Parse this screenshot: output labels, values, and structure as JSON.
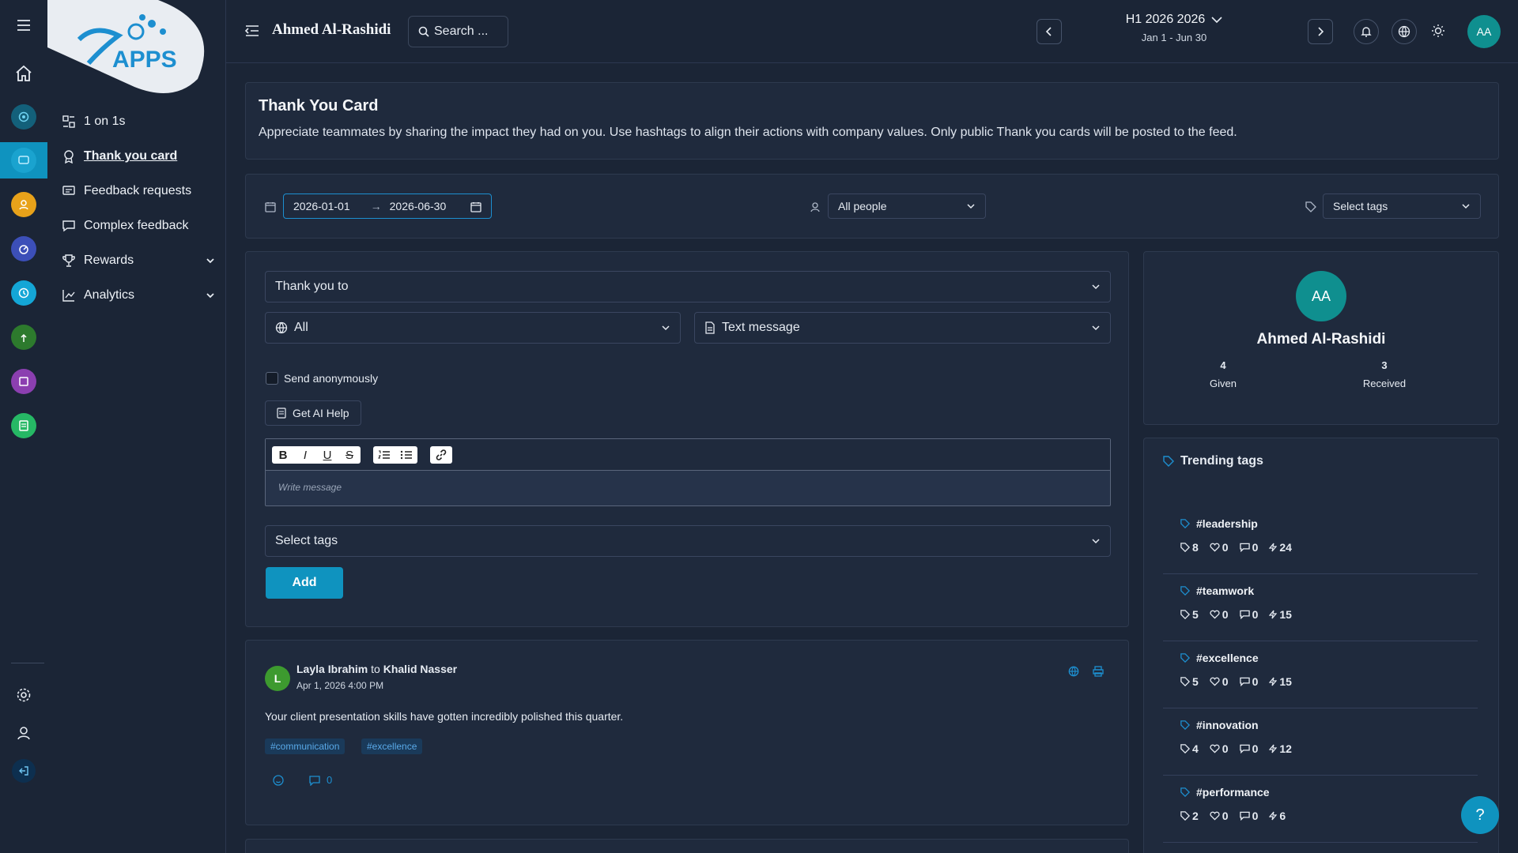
{
  "logo": {
    "text": "APPS"
  },
  "sidebar": {
    "items": [
      {
        "label": "1 on 1s"
      },
      {
        "label": "Thank you card"
      },
      {
        "label": "Feedback requests"
      },
      {
        "label": "Complex feedback"
      },
      {
        "label": "Rewards"
      },
      {
        "label": "Analytics"
      }
    ]
  },
  "topbar": {
    "user_name": "Ahmed Al-Rashidi",
    "search_label": "Search ...",
    "period_title": "H1 2026 2026",
    "period_range": "Jan 1 - Jun 30",
    "avatar": "AA"
  },
  "header": {
    "title": "Thank You Card",
    "description": "Appreciate teammates by sharing the impact they had on you. Use hashtags to align their actions with company values. Only public Thank you cards will be posted to the feed."
  },
  "filters": {
    "date_from": "2026-01-01",
    "date_arrow": "→",
    "date_to": "2026-06-30",
    "people": "All people",
    "tags": "Select tags"
  },
  "form": {
    "recipient_placeholder": "Thank you to",
    "visibility": "All",
    "message_type": "Text message",
    "anonymous_label": "Send anonymously",
    "ai_help": "Get AI Help",
    "toolbar": {
      "bold": "B",
      "italic": "I",
      "underline": "U",
      "strike": "S"
    },
    "message_placeholder": "Write message",
    "tags_placeholder": "Select tags",
    "add_label": "Add"
  },
  "feed": [
    {
      "avatar": "L",
      "from": "Layla Ibrahim",
      "connector": "to",
      "to": "Khalid Nasser",
      "time": "Apr 1, 2026 4:00 PM",
      "message": "Your client presentation skills have gotten incredibly polished this quarter.",
      "tags": [
        "#communication",
        "#excellence"
      ],
      "comments": "0"
    }
  ],
  "profile": {
    "avatar": "AA",
    "name": "Ahmed Al-Rashidi",
    "given_count": "4",
    "given_label": "Given",
    "received_count": "3",
    "received_label": "Received"
  },
  "trending": {
    "title": "Trending tags",
    "tags": [
      {
        "name": "#leadership",
        "uses": "8",
        "likes": "0",
        "comments": "0",
        "score": "24"
      },
      {
        "name": "#teamwork",
        "uses": "5",
        "likes": "0",
        "comments": "0",
        "score": "15"
      },
      {
        "name": "#excellence",
        "uses": "5",
        "likes": "0",
        "comments": "0",
        "score": "15"
      },
      {
        "name": "#innovation",
        "uses": "4",
        "likes": "0",
        "comments": "0",
        "score": "12"
      },
      {
        "name": "#performance",
        "uses": "2",
        "likes": "0",
        "comments": "0",
        "score": "6"
      }
    ]
  },
  "help": {
    "label": "?"
  },
  "colors": {
    "accent": "#0f93bf",
    "background": "#1b2536",
    "card": "#1f2a3d",
    "avatar": "#0f8f8f",
    "feed_avatar": "#3d9a2f"
  }
}
